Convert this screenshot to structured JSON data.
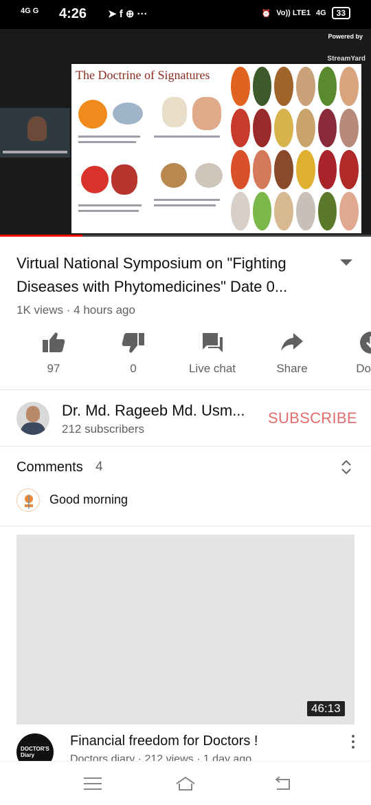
{
  "status_bar": {
    "network": "4G G",
    "time": "4:26",
    "notification_icons": "➤ f ⊕ ···",
    "lte": "Vo)) LTE1",
    "network2": "4G",
    "battery": "33"
  },
  "player": {
    "slide_title": "The Doctrine of Signatures",
    "powered_by": "Powered by",
    "provider": "StreamYard"
  },
  "video": {
    "title": "Virtual National Symposium on \"Fighting Diseases with Phytomedicines\" Date 0...",
    "views": "1K views",
    "separator": "·",
    "age": "4 hours ago"
  },
  "actions": {
    "like_count": "97",
    "dislike_count": "0",
    "live_chat": "Live chat",
    "share": "Share",
    "download": "Down"
  },
  "channel": {
    "name": "Dr. Md. Rageeb Md. Usm...",
    "subscribers": "212 subscribers",
    "subscribe_label": "SUBSCRIBE"
  },
  "comments": {
    "heading": "Comments",
    "count": "4",
    "top_comment": "Good morning"
  },
  "next_video": {
    "duration": "46:13",
    "title": "Financial freedom for Doctors !",
    "meta": "Doctors diary · 212 views · 1 day ago",
    "channel_avatar_text": "DOCTOR'S Diary"
  },
  "colors": {
    "subscribe": "#e06c6c",
    "progress": "#ff0000",
    "secondary_text": "#606060"
  },
  "icons": [
    "thumbs-up-icon",
    "thumbs-down-icon",
    "live-chat-icon",
    "share-icon",
    "download-icon",
    "sort-icon",
    "menu-icon",
    "home-icon",
    "back-icon"
  ]
}
